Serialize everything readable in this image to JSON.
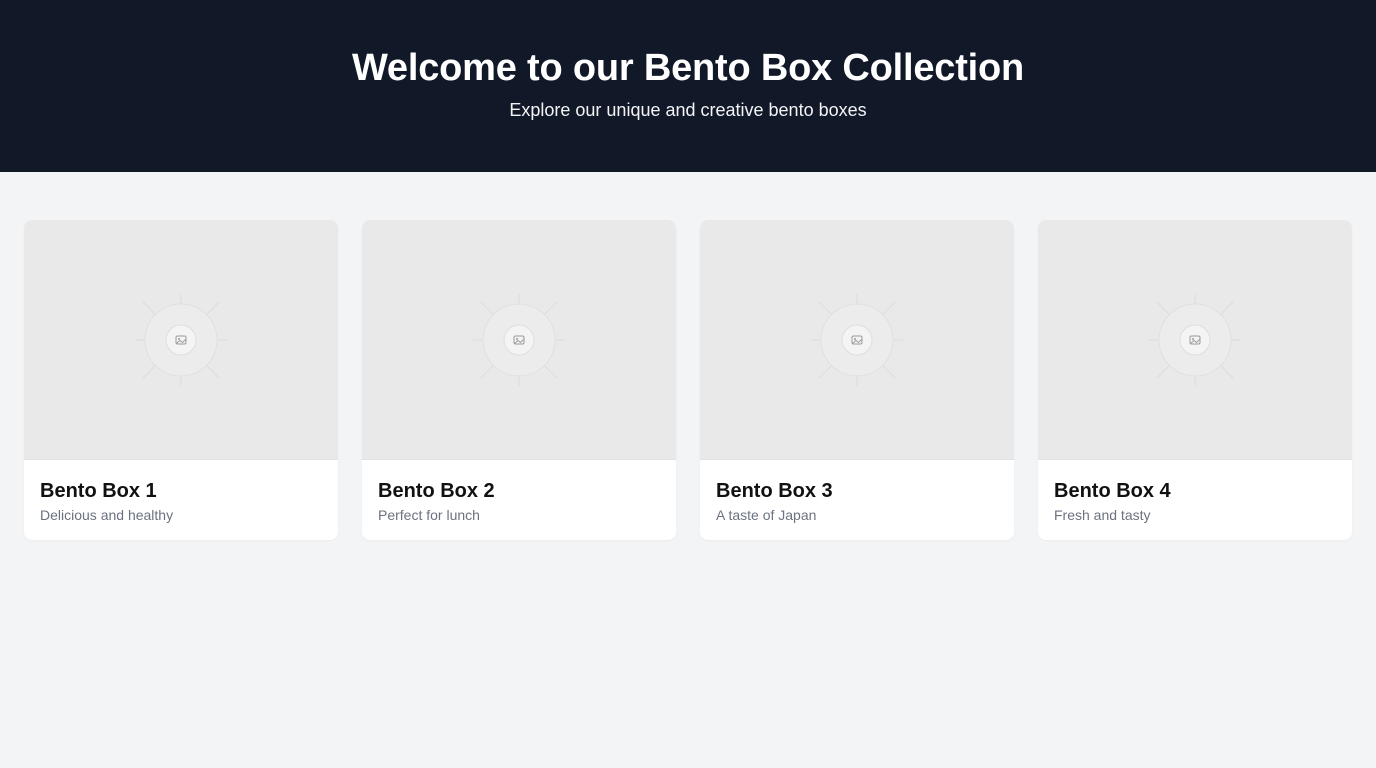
{
  "header": {
    "title": "Welcome to our Bento Box Collection",
    "subtitle": "Explore our unique and creative bento boxes"
  },
  "cards": [
    {
      "title": "Bento Box 1",
      "description": "Delicious and healthy",
      "image_icon": "image-placeholder-icon"
    },
    {
      "title": "Bento Box 2",
      "description": "Perfect for lunch",
      "image_icon": "image-placeholder-icon"
    },
    {
      "title": "Bento Box 3",
      "description": "A taste of Japan",
      "image_icon": "image-placeholder-icon"
    },
    {
      "title": "Bento Box 4",
      "description": "Fresh and tasty",
      "image_icon": "image-placeholder-icon"
    }
  ],
  "colors": {
    "header_bg": "#111827",
    "page_bg": "#f3f4f6",
    "card_bg": "#ffffff",
    "image_bg": "#e9e9e9",
    "muted_text": "#6b7280"
  }
}
